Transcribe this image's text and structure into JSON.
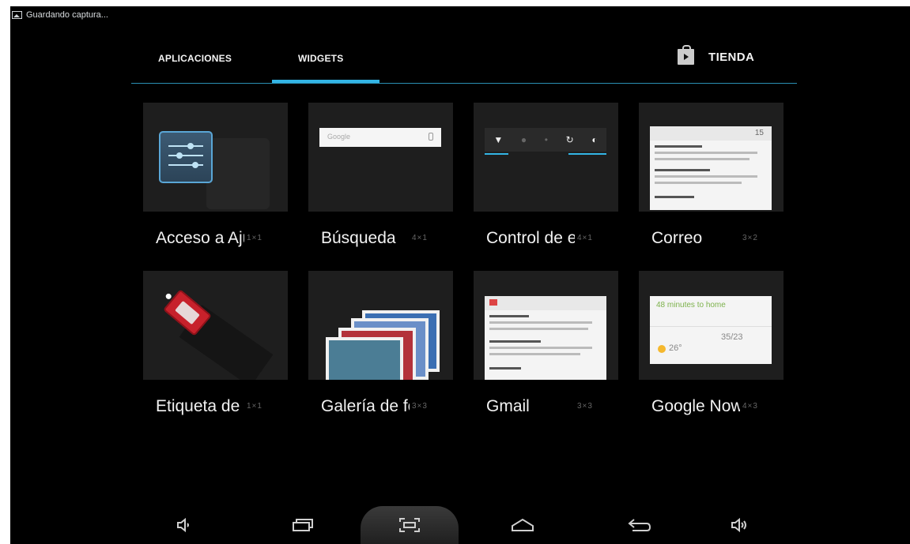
{
  "status_bar": {
    "notification": "Guardando captura...",
    "notification_icon": "picture-icon"
  },
  "tabs": [
    {
      "label": "APLICACIONES",
      "active": false
    },
    {
      "label": "WIDGETS",
      "active": true
    }
  ],
  "store": {
    "label": "TIENDA",
    "icon": "play-store-icon"
  },
  "widgets": [
    {
      "name": "Acceso a Ajustes",
      "size": "1×1"
    },
    {
      "name": "Búsqueda",
      "size": "4×1"
    },
    {
      "name": "Control de energía",
      "size": "4×1"
    },
    {
      "name": "Correo",
      "size": "3×2"
    },
    {
      "name": "Etiqueta de NFC",
      "size": "1×1"
    },
    {
      "name": "Galería de fotos",
      "size": "3×3"
    },
    {
      "name": "Gmail",
      "size": "3×3"
    },
    {
      "name": "Google Now",
      "size": "4×3"
    }
  ],
  "thumb_text": {
    "search": "Google",
    "weather_title": "48 minutes to home",
    "weather_temp": "26°",
    "weather_temp2": "35/23",
    "mail_count": "15"
  },
  "nav": [
    "volume-down-icon",
    "recent-apps-icon",
    "screenshot-icon",
    "home-icon",
    "back-icon",
    "volume-up-icon"
  ],
  "colors": {
    "accent": "#33b5e5",
    "background": "#000000"
  }
}
